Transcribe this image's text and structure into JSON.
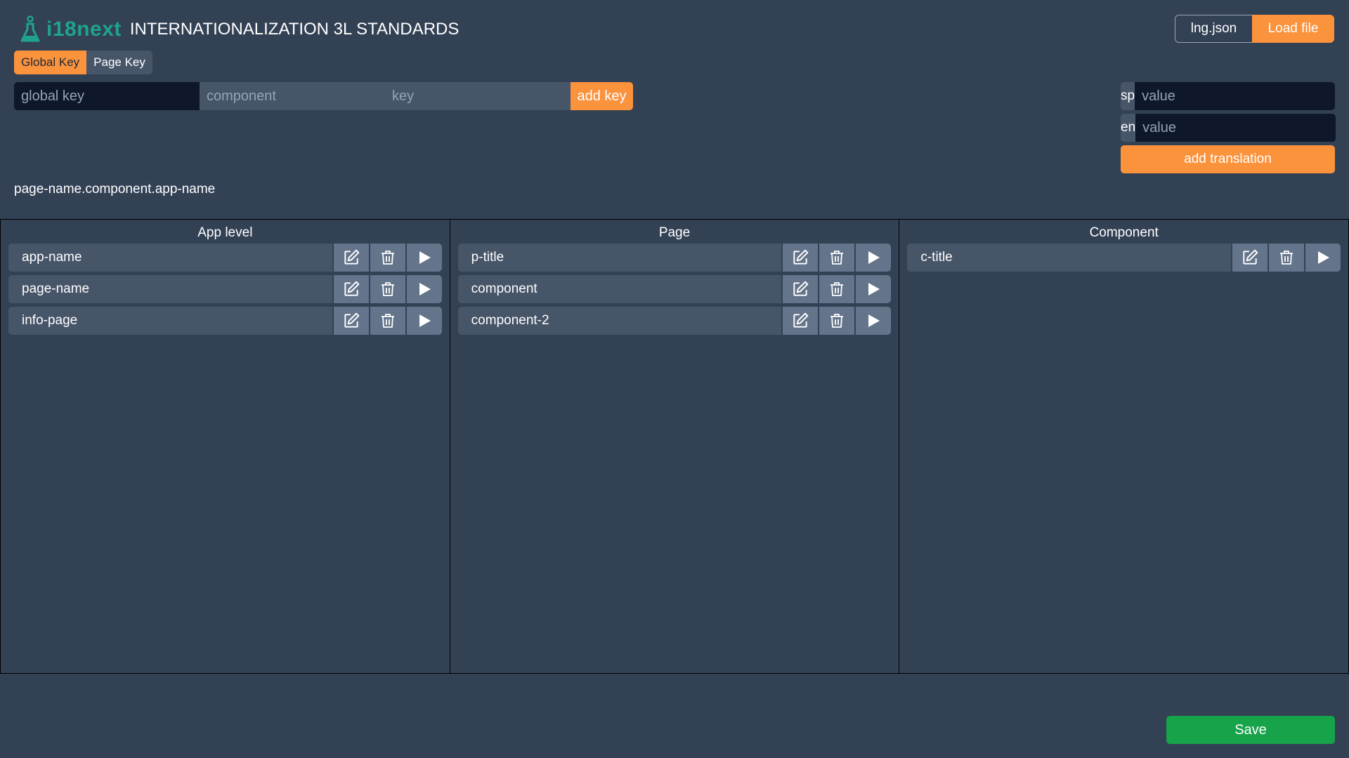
{
  "header": {
    "brand": "i18next",
    "title": "INTERNATIONALIZATION 3L STANDARDS",
    "brand_color": "#1fa38d",
    "logo_icon": "flask-icon"
  },
  "file": {
    "name": "lng.json",
    "load_label": "Load file"
  },
  "key_tabs": {
    "global_label": "Global Key",
    "page_label": "Page Key",
    "active": "Global Key"
  },
  "key_form": {
    "global_placeholder": "global key",
    "component_placeholder": "component",
    "key_placeholder": "key",
    "add_label": "add key"
  },
  "translation": {
    "languages": [
      {
        "code": "sp",
        "placeholder": "value"
      },
      {
        "code": "en",
        "placeholder": "value"
      }
    ],
    "add_label": "add translation"
  },
  "key_path": "page-name.component.app-name",
  "columns": [
    {
      "title": "App level",
      "items": [
        {
          "label": "app-name"
        },
        {
          "label": "page-name"
        },
        {
          "label": "info-page"
        }
      ]
    },
    {
      "title": "Page",
      "items": [
        {
          "label": "p-title"
        },
        {
          "label": "component"
        },
        {
          "label": "component-2"
        }
      ]
    },
    {
      "title": "Component",
      "items": [
        {
          "label": "c-title"
        }
      ]
    }
  ],
  "item_actions": [
    "edit-icon",
    "trash-icon",
    "play-icon"
  ],
  "save_label": "Save",
  "colors": {
    "background": "#334155",
    "accent": "#fb923c",
    "save": "#16a34a",
    "input_dark": "#0f172a",
    "item_bg": "#475569",
    "action_bg": "#64748b"
  }
}
